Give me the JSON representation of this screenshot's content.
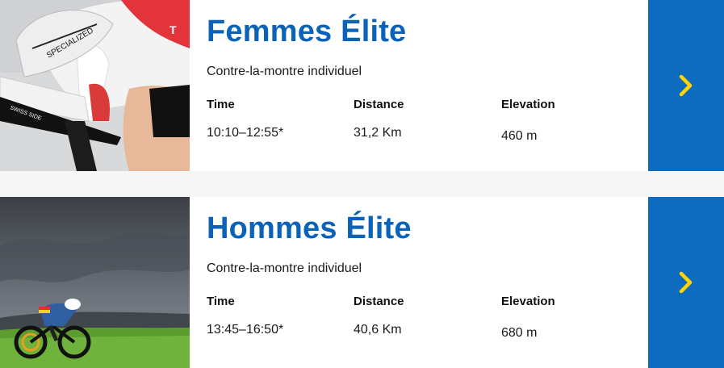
{
  "colors": {
    "title": "#0a63b8",
    "button_bg": "#0d6cc0",
    "chevron": "#ffd200"
  },
  "races": [
    {
      "title": "Femmes Élite",
      "subtitle": "Contre-la-montre individuel",
      "time_label": "Time",
      "time_value": "10:10–12:55*",
      "distance_label": "Distance",
      "distance_value": "31,2 Km",
      "elevation_label": "Elevation",
      "elevation_value": "460 m",
      "image_logo_text": [
        "SPECIALIZED",
        "SWISS SIDE",
        "T"
      ],
      "action_icon": "chevron-right-icon"
    },
    {
      "title": "Hommes Élite",
      "subtitle": "Contre-la-montre individuel",
      "time_label": "Time",
      "time_value": "13:45–16:50*",
      "distance_label": "Distance",
      "distance_value": "40,6 Km",
      "elevation_label": "Elevation",
      "elevation_value": "680 m",
      "action_icon": "chevron-right-icon"
    }
  ]
}
